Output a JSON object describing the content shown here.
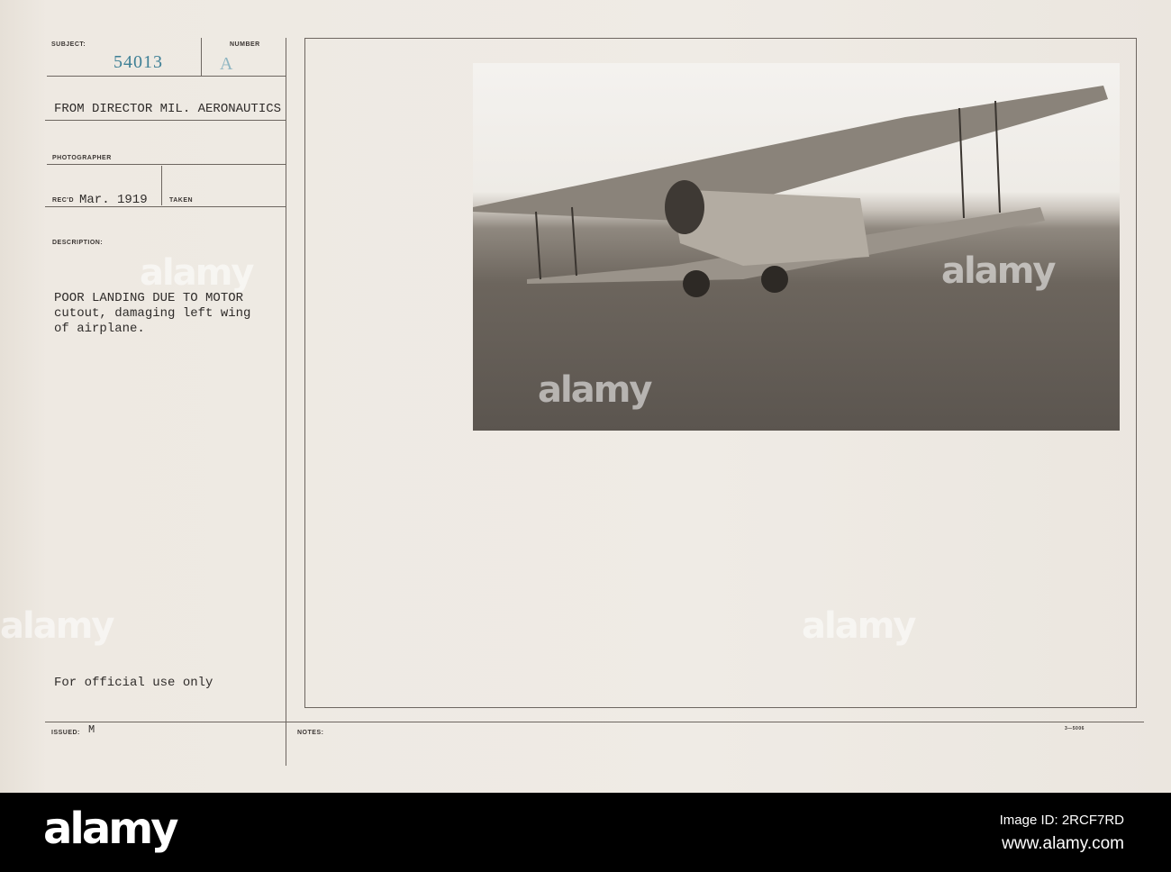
{
  "card": {
    "subject_label": "SUBJECT:",
    "subject_value": "54013",
    "number_label": "NUMBER",
    "number_value": "A",
    "from": "FROM DIRECTOR MIL. AERONAUTICS",
    "photographer_label": "PHOTOGRAPHER",
    "recd_label": "REC'D",
    "recd_value": "Mar. 1919",
    "taken_label": "TAKEN",
    "description_label": "DESCRIPTION:",
    "description_lines": [
      "POOR LANDING DUE TO MOTOR",
      "cutout, damaging left wing",
      "of airplane."
    ],
    "official": "For official use only",
    "issued_label": "ISSUED:",
    "issued_value": "M",
    "notes_label": "NOTES:",
    "form_number": "3—5006"
  },
  "watermark": "alamy",
  "footer": {
    "logo": "alamy",
    "image_id": "Image ID: 2RCF7RD",
    "url": "www.alamy.com"
  }
}
